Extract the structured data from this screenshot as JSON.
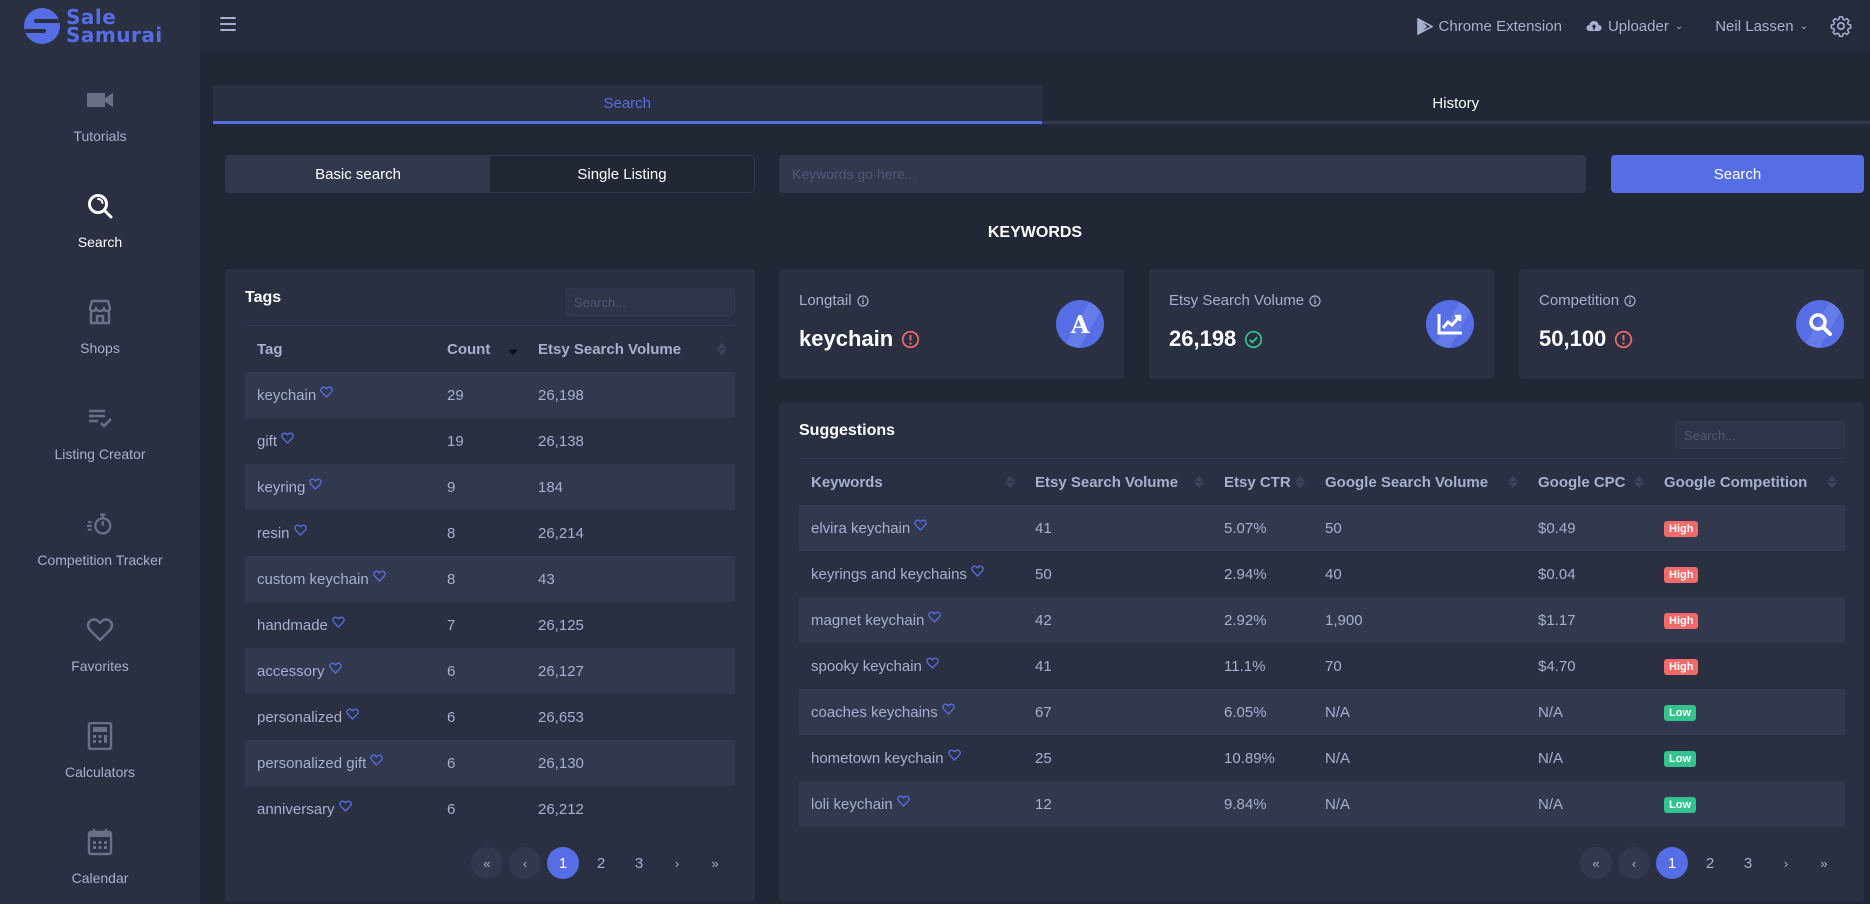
{
  "app": {
    "brand_line1": "Sale",
    "brand_line2": "Samurai",
    "accent_color": "#556ee6"
  },
  "topbar": {
    "chrome_extension": "Chrome Extension",
    "uploader": "Uploader",
    "user_name": "Neil Lassen"
  },
  "sidebar": {
    "items": [
      {
        "label": "Tutorials",
        "icon": "video-camera-icon"
      },
      {
        "label": "Search",
        "icon": "search-icon",
        "active": true
      },
      {
        "label": "Shops",
        "icon": "store-icon"
      },
      {
        "label": "Listing Creator",
        "icon": "list-check-icon"
      },
      {
        "label": "Competition Tracker",
        "icon": "stopwatch-icon"
      },
      {
        "label": "Favorites",
        "icon": "heart-icon"
      },
      {
        "label": "Calculators",
        "icon": "calculator-icon"
      },
      {
        "label": "Calendar",
        "icon": "calendar-icon"
      }
    ]
  },
  "tabs": {
    "search": "Search",
    "history": "History"
  },
  "search_mode": {
    "basic": "Basic search",
    "single": "Single Listing"
  },
  "keyword_input": {
    "value": "",
    "placeholder": "Keywords go here..."
  },
  "search_button": "Search",
  "section_title": "KEYWORDS",
  "tags": {
    "title": "Tags",
    "search_placeholder": "Search...",
    "columns": [
      "Tag",
      "Count",
      "Etsy Search Volume"
    ],
    "rows": [
      {
        "tag": "keychain",
        "count": "29",
        "volume": "26,198"
      },
      {
        "tag": "gift",
        "count": "19",
        "volume": "26,138"
      },
      {
        "tag": "keyring",
        "count": "9",
        "volume": "184"
      },
      {
        "tag": "resin",
        "count": "8",
        "volume": "26,214"
      },
      {
        "tag": "custom keychain",
        "count": "8",
        "volume": "43"
      },
      {
        "tag": "handmade",
        "count": "7",
        "volume": "26,125"
      },
      {
        "tag": "accessory",
        "count": "6",
        "volume": "26,127"
      },
      {
        "tag": "personalized",
        "count": "6",
        "volume": "26,653"
      },
      {
        "tag": "personalized gift",
        "count": "6",
        "volume": "26,130"
      },
      {
        "tag": "anniversary",
        "count": "6",
        "volume": "26,212"
      }
    ],
    "pagination": {
      "first": "«",
      "prev": "‹",
      "pages": [
        "1",
        "2",
        "3"
      ],
      "current": "1",
      "next": "›",
      "last": "»"
    }
  },
  "stats": {
    "longtail": {
      "label": "Longtail",
      "value": "keychain",
      "status": "warning",
      "icon": "letter-a-icon"
    },
    "volume": {
      "label": "Etsy Search Volume",
      "value": "26,198",
      "status": "good",
      "icon": "chart-line-icon"
    },
    "competition": {
      "label": "Competition",
      "value": "50,100",
      "status": "warning",
      "icon": "search-icon"
    }
  },
  "suggestions": {
    "title": "Suggestions",
    "search_placeholder": "Search...",
    "columns": [
      "Keywords",
      "Etsy Search Volume",
      "Etsy CTR",
      "Google Search Volume",
      "Google CPC",
      "Google Competition"
    ],
    "rows": [
      {
        "keyword": "elvira keychain",
        "etsy_volume": "41",
        "ctr": "5.07%",
        "google_volume": "50",
        "cpc": "$0.49",
        "competition": "High"
      },
      {
        "keyword": "keyrings and keychains",
        "etsy_volume": "50",
        "ctr": "2.94%",
        "google_volume": "40",
        "cpc": "$0.04",
        "competition": "High"
      },
      {
        "keyword": "magnet keychain",
        "etsy_volume": "42",
        "ctr": "2.92%",
        "google_volume": "1,900",
        "cpc": "$1.17",
        "competition": "High"
      },
      {
        "keyword": "spooky keychain",
        "etsy_volume": "41",
        "ctr": "11.1%",
        "google_volume": "70",
        "cpc": "$4.70",
        "competition": "High"
      },
      {
        "keyword": "coaches keychains",
        "etsy_volume": "67",
        "ctr": "6.05%",
        "google_volume": "N/A",
        "cpc": "N/A",
        "competition": "Low"
      },
      {
        "keyword": "hometown keychain",
        "etsy_volume": "25",
        "ctr": "10.89%",
        "google_volume": "N/A",
        "cpc": "N/A",
        "competition": "Low"
      },
      {
        "keyword": "loli keychain",
        "etsy_volume": "12",
        "ctr": "9.84%",
        "google_volume": "N/A",
        "cpc": "N/A",
        "competition": "Low"
      }
    ],
    "pagination": {
      "first": "«",
      "prev": "‹",
      "pages": [
        "1",
        "2",
        "3"
      ],
      "current": "1",
      "next": "›",
      "last": "»"
    }
  }
}
